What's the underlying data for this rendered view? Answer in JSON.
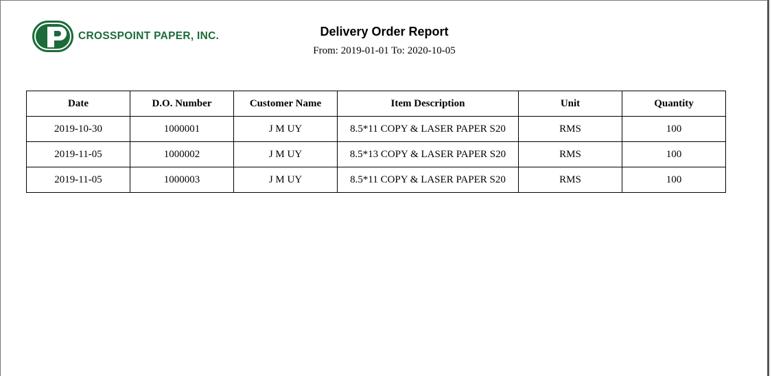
{
  "company": {
    "name": "CROSSPOINT PAPER, INC.",
    "brand_color": "#1c6b3a",
    "logo_icon": "crosspoint-p-logo"
  },
  "report": {
    "title": "Delivery Order Report",
    "range": "From: 2019-01-01 To: 2020-10-05"
  },
  "table": {
    "headers": {
      "date": "Date",
      "do_number": "D.O. Number",
      "customer": "Customer Name",
      "item": "Item Description",
      "unit": "Unit",
      "quantity": "Quantity"
    },
    "rows": [
      {
        "date": "2019-10-30",
        "do_number": "1000001",
        "customer": "J M UY",
        "item": "8.5*11 COPY & LASER PAPER S20",
        "unit": "RMS",
        "quantity": "100"
      },
      {
        "date": "2019-11-05",
        "do_number": "1000002",
        "customer": "J M UY",
        "item": "8.5*13 COPY & LASER PAPER S20",
        "unit": "RMS",
        "quantity": "100"
      },
      {
        "date": "2019-11-05",
        "do_number": "1000003",
        "customer": "J M UY",
        "item": "8.5*11 COPY & LASER PAPER S20",
        "unit": "RMS",
        "quantity": "100"
      }
    ]
  }
}
